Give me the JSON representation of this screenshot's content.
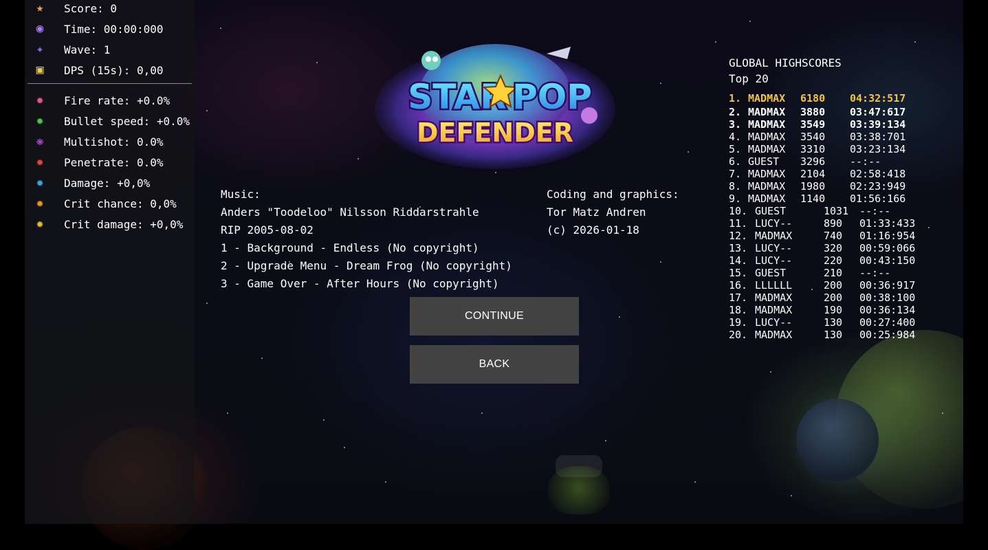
{
  "stats": [
    {
      "icon": "score-gem-icon",
      "glyph": "★",
      "color": "#e8a33a",
      "text": "Score: 0"
    },
    {
      "icon": "time-orb-icon",
      "glyph": "◉",
      "color": "#a77cf0",
      "text": "Time: 00:00:000"
    },
    {
      "icon": "wave-portal-icon",
      "glyph": "✦",
      "color": "#8a6ce8",
      "text": "Wave: 1"
    },
    {
      "icon": "dps-chip-icon",
      "glyph": "▣",
      "color": "#e8d03a",
      "text": "DPS (15s): 0,00"
    }
  ],
  "upgrades": [
    {
      "icon": "fire-rate-icon",
      "glyph": "✹",
      "color": "#e05a8a",
      "text": "Fire rate: +0.0%"
    },
    {
      "icon": "bullet-speed-icon",
      "glyph": "✹",
      "color": "#4fc34a",
      "text": "Bullet speed: +0.0%"
    },
    {
      "icon": "multishot-icon",
      "glyph": "❋",
      "color": "#c25ae0",
      "text": "Multishot: 0.0%"
    },
    {
      "icon": "penetrate-icon",
      "glyph": "✹",
      "color": "#e04a3a",
      "text": "Penetrate: 0.0%"
    },
    {
      "icon": "damage-icon",
      "glyph": "✹",
      "color": "#3aa6e0",
      "text": "Damage: +0,0%"
    },
    {
      "icon": "crit-chance-icon",
      "glyph": "✹",
      "color": "#e09a2a",
      "text": "Crit chance: 0,0%"
    },
    {
      "icon": "crit-damage-icon",
      "glyph": "✹",
      "color": "#e8b83a",
      "text": "Crit damage: +0,0%"
    }
  ],
  "logo": {
    "line1": "STAR",
    "line1b": "POP",
    "line2": "DEFENDER"
  },
  "credits": {
    "music_label": "Music:",
    "music_author": "Anders \"Toodeloo\" Nilsson Riddarstrahle",
    "rip": "RIP 2005-08-02",
    "tracks": [
      "1 - Background - Endless (No copyright)",
      "2 - Upgrade Menu - Dream Frog (No copyright)",
      "3 - Game Over - After Hours (No copyright)"
    ],
    "coding_label": "Coding and graphics:",
    "coding_author": "Tor Matz Andren",
    "copyright": "(c) 2026-01-18"
  },
  "buttons": {
    "continue": "CONTINUE",
    "back": "BACK"
  },
  "highscores": {
    "title": "GLOBAL HIGHSCORES",
    "subtitle": "Top 20",
    "rows": [
      {
        "rank": "1.",
        "name": "MADMAX",
        "score": "6180",
        "time": "04:32:517"
      },
      {
        "rank": "2.",
        "name": "MADMAX",
        "score": "3880",
        "time": "03:47:617"
      },
      {
        "rank": "3.",
        "name": "MADMAX",
        "score": "3549",
        "time": "03:39:134"
      },
      {
        "rank": "4.",
        "name": "MADMAX",
        "score": "3540",
        "time": "03:38:701"
      },
      {
        "rank": "5.",
        "name": "MADMAX",
        "score": "3310",
        "time": "03:23:134"
      },
      {
        "rank": "6.",
        "name": "GUEST",
        "score": "3296",
        "time": "--:--"
      },
      {
        "rank": "7.",
        "name": "MADMAX",
        "score": "2104",
        "time": "02:58:418"
      },
      {
        "rank": "8.",
        "name": "MADMAX",
        "score": "1980",
        "time": "02:23:949"
      },
      {
        "rank": "9.",
        "name": "MADMAX",
        "score": "1140",
        "time": "01:56:166"
      },
      {
        "rank": "10.",
        "name": "GUEST",
        "score": "1031",
        "time": "--:--"
      },
      {
        "rank": "11.",
        "name": "LUCY--",
        "score": "890",
        "time": "01:33:433"
      },
      {
        "rank": "12.",
        "name": "MADMAX",
        "score": "740",
        "time": "01:16:954"
      },
      {
        "rank": "13.",
        "name": "LUCY--",
        "score": "320",
        "time": "00:59:066"
      },
      {
        "rank": "14.",
        "name": "LUCY--",
        "score": "220",
        "time": "00:43:150"
      },
      {
        "rank": "15.",
        "name": "GUEST",
        "score": "210",
        "time": "--:--"
      },
      {
        "rank": "16.",
        "name": "LLLLLL",
        "score": "200",
        "time": "00:36:917"
      },
      {
        "rank": "17.",
        "name": "MADMAX",
        "score": "200",
        "time": "00:38:100"
      },
      {
        "rank": "18.",
        "name": "MADMAX",
        "score": "190",
        "time": "00:36:134"
      },
      {
        "rank": "19.",
        "name": "LUCY--",
        "score": "130",
        "time": "00:27:400"
      },
      {
        "rank": "20.",
        "name": "MADMAX",
        "score": "130",
        "time": "00:25:984"
      }
    ]
  },
  "colors": {
    "gold": "#f4c242",
    "button_bg": "#434343",
    "panel_bg": "#141416"
  }
}
